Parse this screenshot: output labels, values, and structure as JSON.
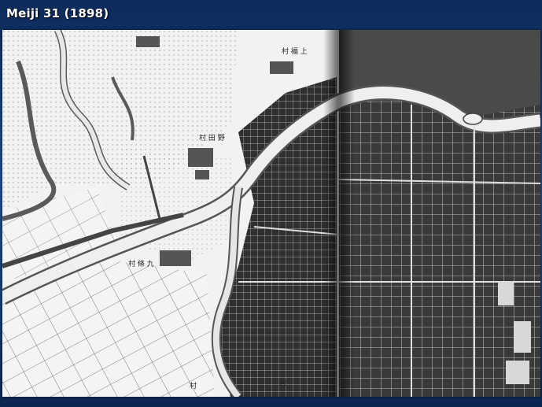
{
  "slide": {
    "title": "Meiji 31 (1898)"
  },
  "map": {
    "kind": "historic city map photograph (two-page atlas spread)",
    "colors": {
      "paper": "#f2f2f0",
      "dense_city": "#3a3a3a",
      "grid_lines": "#cfcfcf",
      "ink": "#222222"
    },
    "labels": [
      {
        "text": "村 福 上",
        "role": "village-label"
      },
      {
        "text": "村 田 野",
        "role": "village-label"
      },
      {
        "text": "村 條 九",
        "role": "village-label"
      },
      {
        "text": "村",
        "role": "village-label"
      },
      {
        "text": "村",
        "role": "village-label"
      }
    ]
  }
}
